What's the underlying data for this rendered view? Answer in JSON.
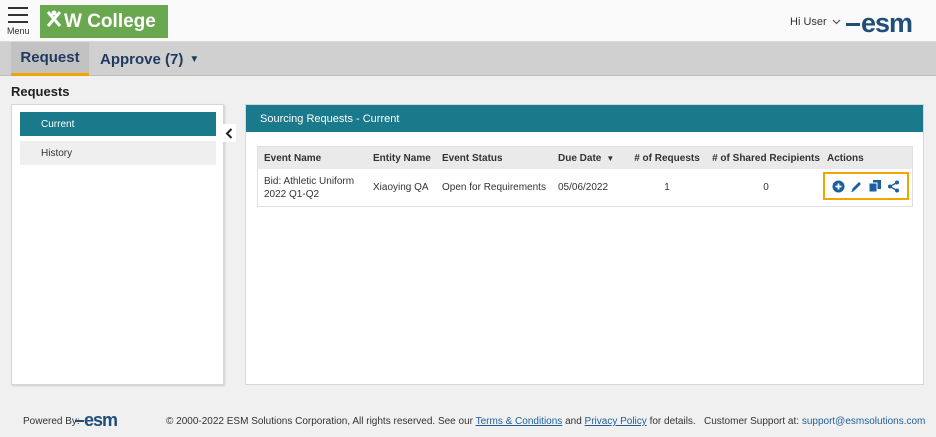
{
  "header": {
    "menu_label": "Menu",
    "logo_text": "W College",
    "user_greeting": "Hi User",
    "brand": "esm"
  },
  "tabs": [
    {
      "label": "Request",
      "active": true
    },
    {
      "label": "Approve (7)",
      "active": false
    }
  ],
  "page_title": "Requests",
  "sidebar": {
    "items": [
      {
        "label": "Current",
        "active": true
      },
      {
        "label": "History",
        "active": false
      }
    ]
  },
  "main": {
    "title": "Sourcing Requests - Current",
    "columns": [
      "Event Name",
      "Entity Name",
      "Event Status",
      "Due Date",
      "# of Requests",
      "# of Shared Recipients",
      "Actions"
    ],
    "rows": [
      {
        "event_name": "Bid: Athletic Uniform 2022 Q1-Q2",
        "entity_name": "Xiaoying QA",
        "event_status": "Open for Requirements",
        "due_date": "05/06/2022",
        "requests": "1",
        "shared_recipients": "0",
        "actions": [
          "add-icon",
          "edit-icon",
          "copy-icon",
          "share-icon"
        ]
      }
    ]
  },
  "footer": {
    "powered_by": "Powered By:",
    "brand": "esm",
    "copyright_prefix": "© 2000-2022 ESM Solutions Corporation, All rights reserved. See our",
    "terms_link": "Terms & Conditions",
    "and_text": "and",
    "privacy_link": "Privacy Policy",
    "copyright_suffix": "for details.",
    "support_label": "Customer Support at:",
    "support_email": "support@esmsolutions.com"
  },
  "colors": {
    "teal": "#1a7a8c",
    "highlight": "#f0a500",
    "logo_green": "#6aa84f",
    "brand_blue": "#1f4e79"
  }
}
